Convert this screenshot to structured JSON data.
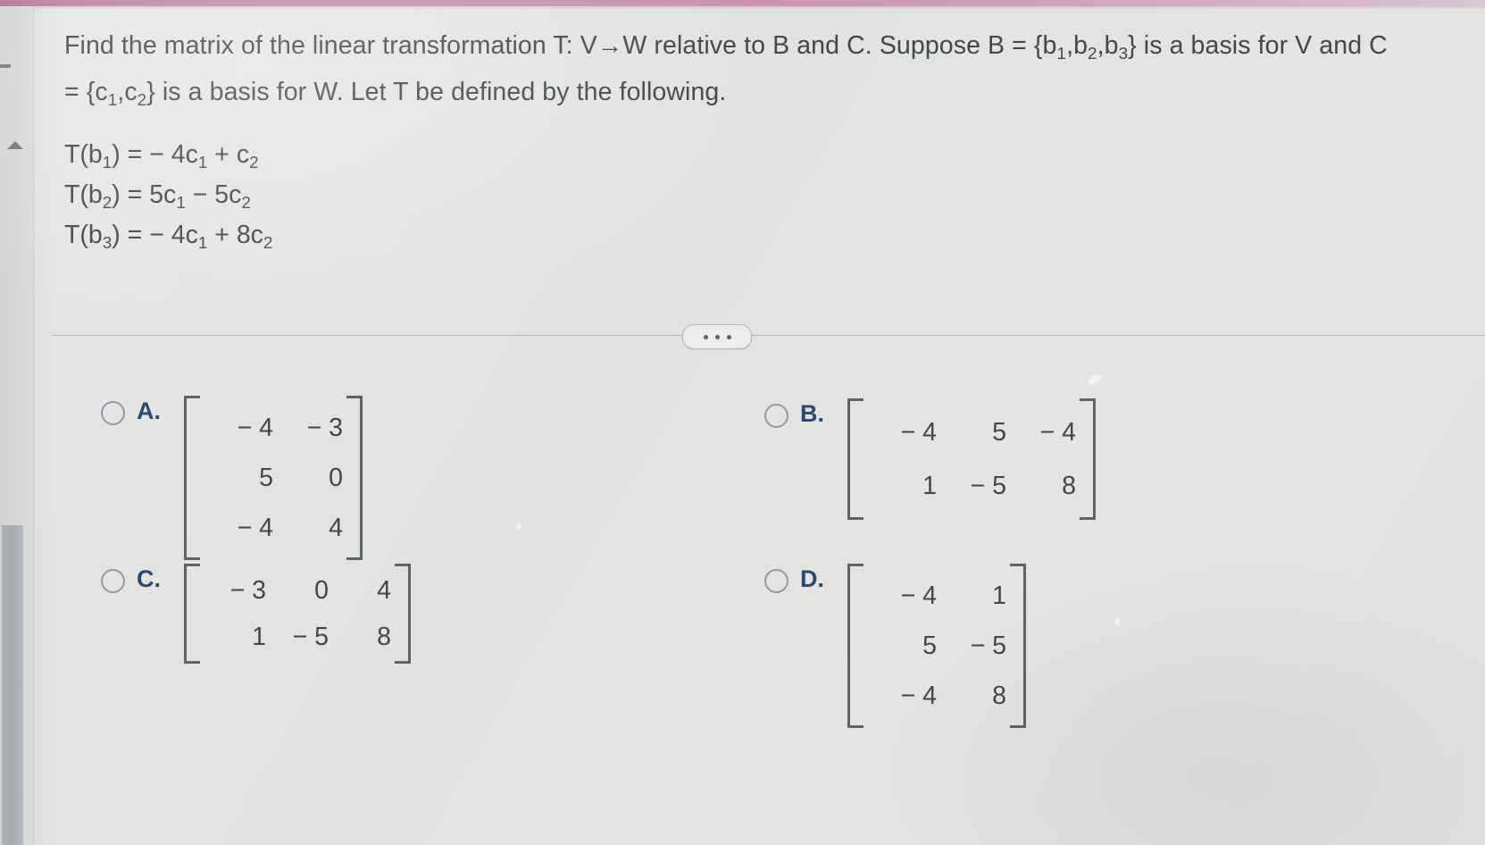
{
  "question": {
    "paragraph_line_1": "Find the matrix of the linear transformation T: V→W relative to B and C. Suppose B = {b",
    "paragraph_text_full": "Find the matrix of the linear transformation T: V→W relative to B and C. Suppose B = {b1,b2,b3} is a basis for V and C = {c1,c2} is a basis for W. Let T be defined by the following.",
    "parts": {
      "p1": "Find the matrix of the linear transformation T: V→W relative to B and C. Suppose B = {b",
      "s1": "1",
      "p2": ",b",
      "s2": "2",
      "p3": ",b",
      "s3": "3",
      "p4": "} is a basis for V and C = {c",
      "s4": "1",
      "p5": ",c",
      "s5": "2",
      "p6": "} is a basis for W. Let T be defined by the following."
    },
    "equations": [
      {
        "lhs_fn": "T(b",
        "lhs_sub": "1",
        "lhs_close": ") = ",
        "rhs": "− 4c",
        "rhs_sub1": "1",
        "rhs_op": " + c",
        "rhs_sub2": "2",
        "plain": "T(b1) = −4c1 + c2"
      },
      {
        "lhs_fn": "T(b",
        "lhs_sub": "2",
        "lhs_close": ") = ",
        "rhs": "5c",
        "rhs_sub1": "1",
        "rhs_op": " − 5c",
        "rhs_sub2": "2",
        "plain": "T(b2) = 5c1 − 5c2"
      },
      {
        "lhs_fn": "T(b",
        "lhs_sub": "3",
        "lhs_close": ") = ",
        "rhs": "− 4c",
        "rhs_sub1": "1",
        "rhs_op": " + 8c",
        "rhs_sub2": "2",
        "plain": "T(b3) = −4c1 + 8c2"
      }
    ]
  },
  "divider": {
    "ellipsis_label": "..."
  },
  "options": [
    {
      "id": "A",
      "letter": "A.",
      "selected": false,
      "matrix": [
        [
          "− 4",
          "− 3"
        ],
        [
          "5",
          "0"
        ],
        [
          "− 4",
          "4"
        ]
      ]
    },
    {
      "id": "B",
      "letter": "B.",
      "selected": false,
      "matrix": [
        [
          "− 4",
          "5",
          "− 4"
        ],
        [
          "1",
          "− 5",
          "8"
        ]
      ]
    },
    {
      "id": "C",
      "letter": "C.",
      "selected": false,
      "matrix": [
        [
          "− 3",
          "0",
          "4"
        ],
        [
          "1",
          "− 5",
          "8"
        ]
      ]
    },
    {
      "id": "D",
      "letter": "D.",
      "selected": false,
      "matrix": [
        [
          "− 4",
          "1"
        ],
        [
          "5",
          "− 5"
        ],
        [
          "− 4",
          "8"
        ]
      ]
    }
  ],
  "chrome": {
    "scroll_up_icon": "triangle-up-icon",
    "scrollbar_icon": "vertical-scrollbar",
    "top_accent_color": "#c07fa3",
    "radio_color": "#8d98ad",
    "option_letter_color": "#2b4a72",
    "text_color": "#41474c",
    "background_color": "#e3e4e2"
  }
}
